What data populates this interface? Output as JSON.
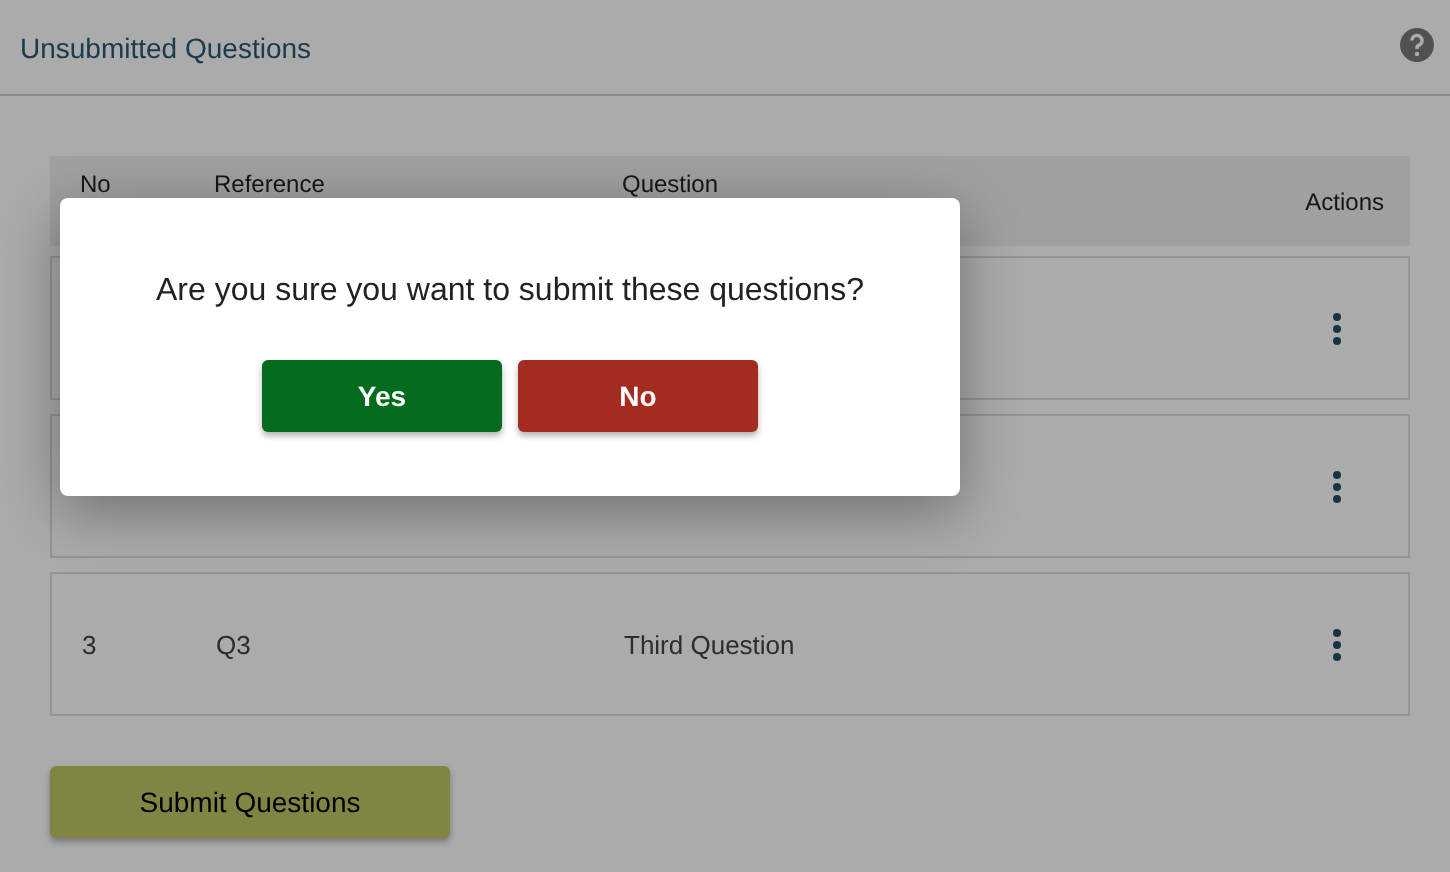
{
  "page": {
    "title": "Unsubmitted Questions"
  },
  "table": {
    "columns": [
      "No",
      "Reference",
      "Question",
      "Actions"
    ],
    "rows": [
      {},
      {},
      {
        "no": "3",
        "reference": "Q3",
        "question": "Third Question"
      }
    ]
  },
  "submit_button": "Submit Questions",
  "dialog": {
    "message": "Are you sure you want to submit these questions?",
    "buttons": [
      {
        "label": "Yes",
        "kind": "confirm"
      },
      {
        "label": "No",
        "kind": "cancel"
      }
    ]
  }
}
